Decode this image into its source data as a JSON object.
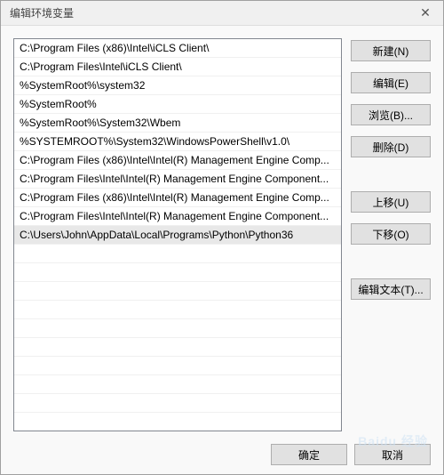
{
  "window": {
    "title": "编辑环境变量"
  },
  "paths": [
    "C:\\Program Files (x86)\\Intel\\iCLS Client\\",
    "C:\\Program Files\\Intel\\iCLS Client\\",
    "%SystemRoot%\\system32",
    "%SystemRoot%",
    "%SystemRoot%\\System32\\Wbem",
    "%SYSTEMROOT%\\System32\\WindowsPowerShell\\v1.0\\",
    "C:\\Program Files (x86)\\Intel\\Intel(R) Management Engine Comp...",
    "C:\\Program Files\\Intel\\Intel(R) Management Engine Component...",
    "C:\\Program Files (x86)\\Intel\\Intel(R) Management Engine Comp...",
    "C:\\Program Files\\Intel\\Intel(R) Management Engine Component...",
    "C:\\Users\\John\\AppData\\Local\\Programs\\Python\\Python36"
  ],
  "selected_index": 10,
  "buttons": {
    "new": "新建(N)",
    "edit": "编辑(E)",
    "browse": "浏览(B)...",
    "delete": "删除(D)",
    "move_up": "上移(U)",
    "move_down": "下移(O)",
    "edit_text": "编辑文本(T)...",
    "ok": "确定",
    "cancel": "取消"
  },
  "watermark": "Baidu 经验"
}
